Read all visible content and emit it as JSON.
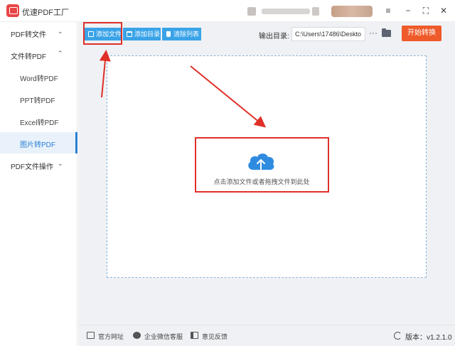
{
  "window": {
    "title": "优速PDF工厂",
    "controls": {
      "menu_icon": "≡",
      "minimize_icon": "−",
      "maximize_icon": "⛶",
      "close_icon": "✕"
    }
  },
  "sidebar": {
    "groups": [
      {
        "label": "PDF转文件",
        "chevron": "⌄",
        "expanded": false
      },
      {
        "label": "文件转PDF",
        "chevron": "⌃",
        "expanded": true
      },
      {
        "label": "PDF文件操作",
        "chevron": "⌄",
        "expanded": false
      }
    ],
    "sub_items": [
      {
        "label": "Word转PDF",
        "active": false
      },
      {
        "label": "PPT转PDF",
        "active": false
      },
      {
        "label": "Excel转PDF",
        "active": false
      },
      {
        "label": "图片转PDF",
        "active": true
      }
    ]
  },
  "toolbar": {
    "add_file_label": "添加文件",
    "add_dir_label": "添加目录",
    "clear_list_label": "清除列表",
    "output_dir_label": "输出目录:",
    "output_path": "C:\\Users\\17486\\Deskto",
    "more_label": "···",
    "start_label": "开始转换",
    "accent_color": "#3aa3e8",
    "start_color": "#ef5a2a"
  },
  "drop_zone": {
    "hint": "点击添加文件或者拖拽文件到此处",
    "icon": "cloud-upload-icon"
  },
  "annotations": {
    "color": "#e0302a"
  },
  "footer": {
    "site_label": "官方网址",
    "wechat_label": "企业微信客服",
    "feedback_label": "意见反馈",
    "version_label": "版本：v1.2.1.0"
  }
}
